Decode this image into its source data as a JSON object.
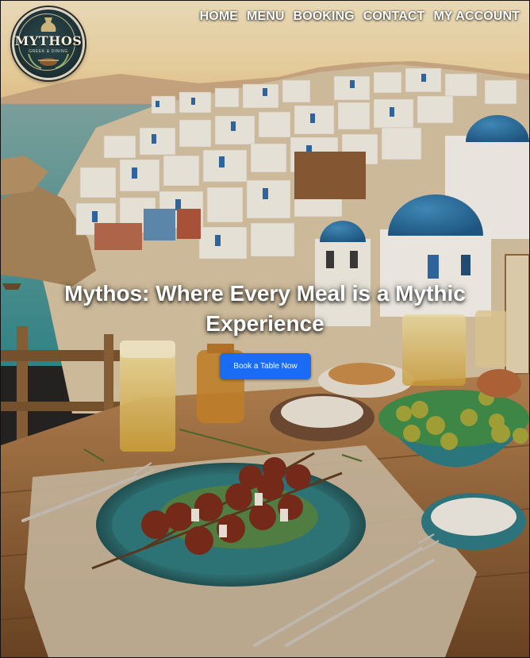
{
  "brand": {
    "logo_name": "MYTHOS",
    "logo_tagline": "GREEK & DINING"
  },
  "nav": {
    "items": [
      {
        "label": "HOME"
      },
      {
        "label": "MENU"
      },
      {
        "label": "BOOKING"
      },
      {
        "label": "CONTACT"
      },
      {
        "label": "MY ACCOUNT"
      }
    ]
  },
  "hero": {
    "headline": "Mythos: Where Every Meal is a Mythic Experience",
    "cta_label": "Book a Table Now",
    "cta_color": "#1a6cf5",
    "image_description_icon": "greek-island-dining-image"
  }
}
